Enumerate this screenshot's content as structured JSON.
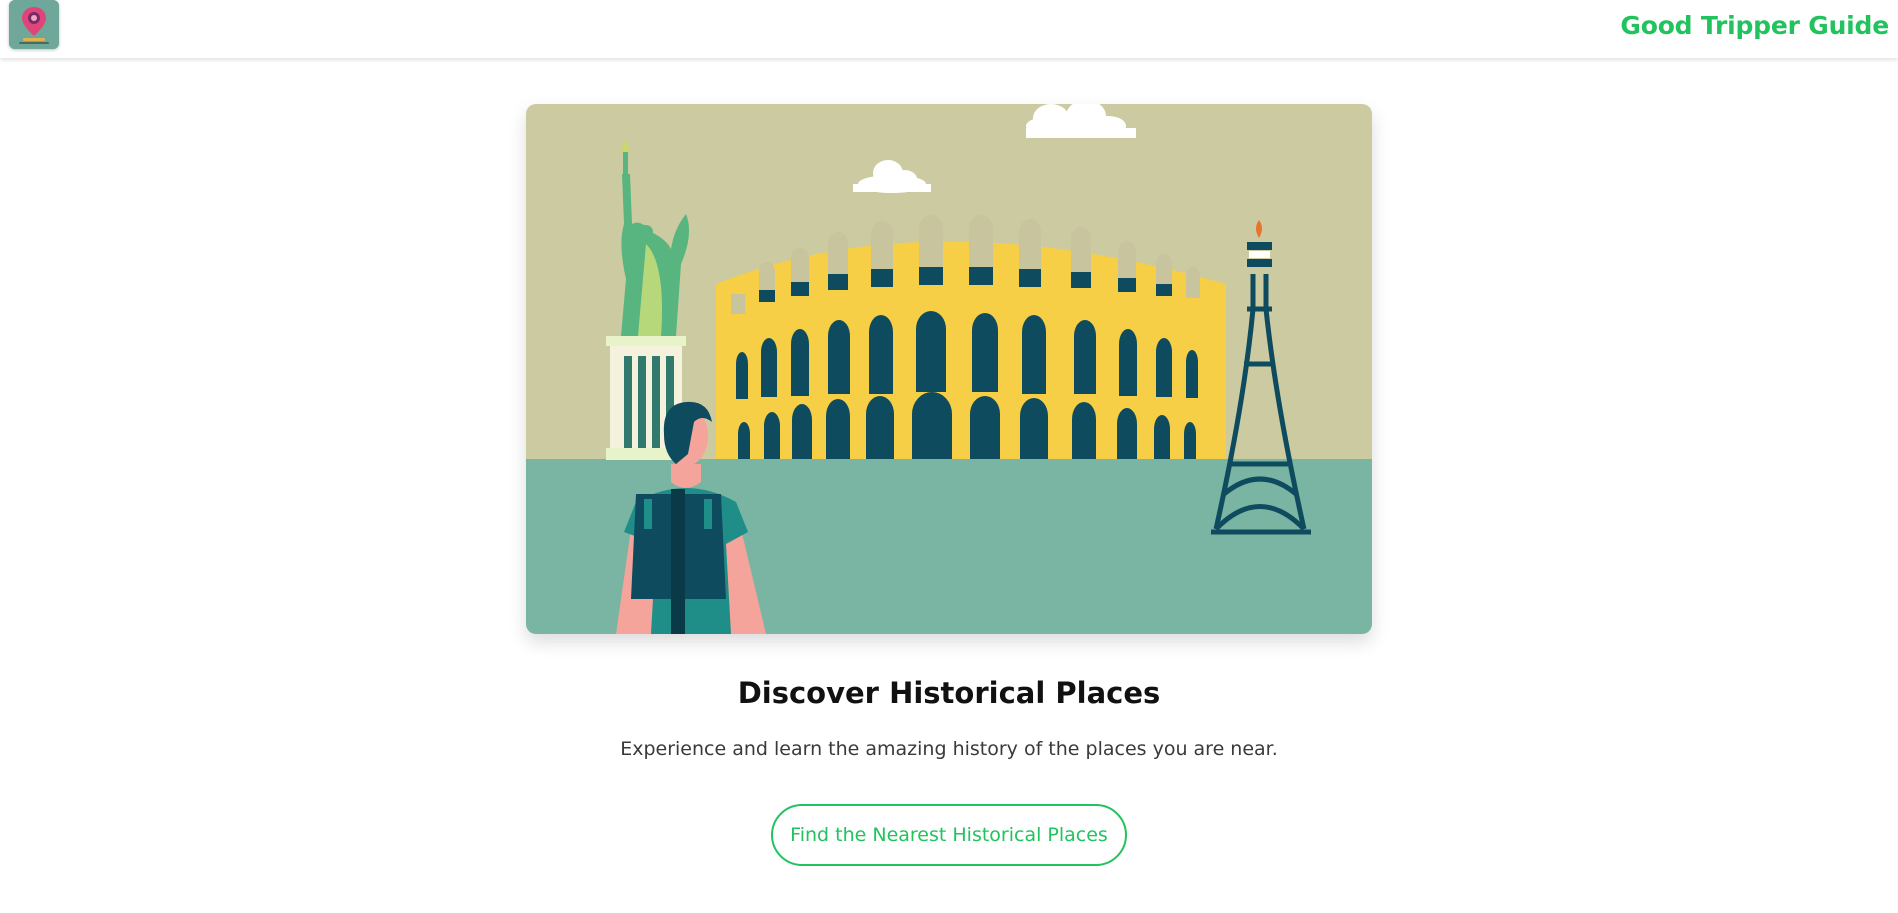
{
  "header": {
    "logo_icon": "map-pin-logo-icon",
    "brand_title": "Good Tripper Guide",
    "brand_color": "#22c35e"
  },
  "hero": {
    "image_name": "historical-landmarks-illustration",
    "landmarks": [
      "statue-of-liberty",
      "colosseum",
      "eiffel-tower"
    ]
  },
  "main": {
    "title": "Discover Historical Places",
    "subtitle": "Experience and learn the amazing history of the places you are near.",
    "cta_label": "Find the Nearest Historical Places"
  }
}
